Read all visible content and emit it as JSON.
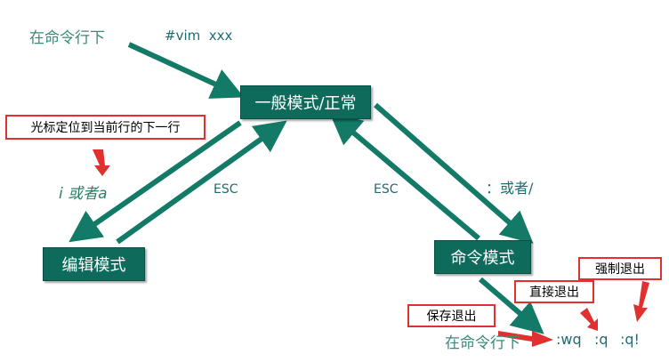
{
  "labels": {
    "start_cmd_line": "在命令行下",
    "vim_cmd": "#vim  xxx",
    "normal_mode": "一般模式/正常",
    "edit_mode": "编辑模式",
    "command_mode": "命令模式",
    "i_or_a": "i 或者a",
    "esc_left": "ESC",
    "esc_right": "ESC",
    "colon_or_slash": "：或者/",
    "cursor_note": "光标定位到当前行的下一行",
    "save_exit": "保存退出",
    "direct_exit": "直接退出",
    "force_exit": "强制退出",
    "end_cmd_line": "在命令行下",
    "wq": ":wq",
    "q": ":q",
    "q_bang": ":q!"
  },
  "colors": {
    "teal_box": "#0e6b5c",
    "teal_arrow": "#127a66",
    "red": "#e03030"
  }
}
